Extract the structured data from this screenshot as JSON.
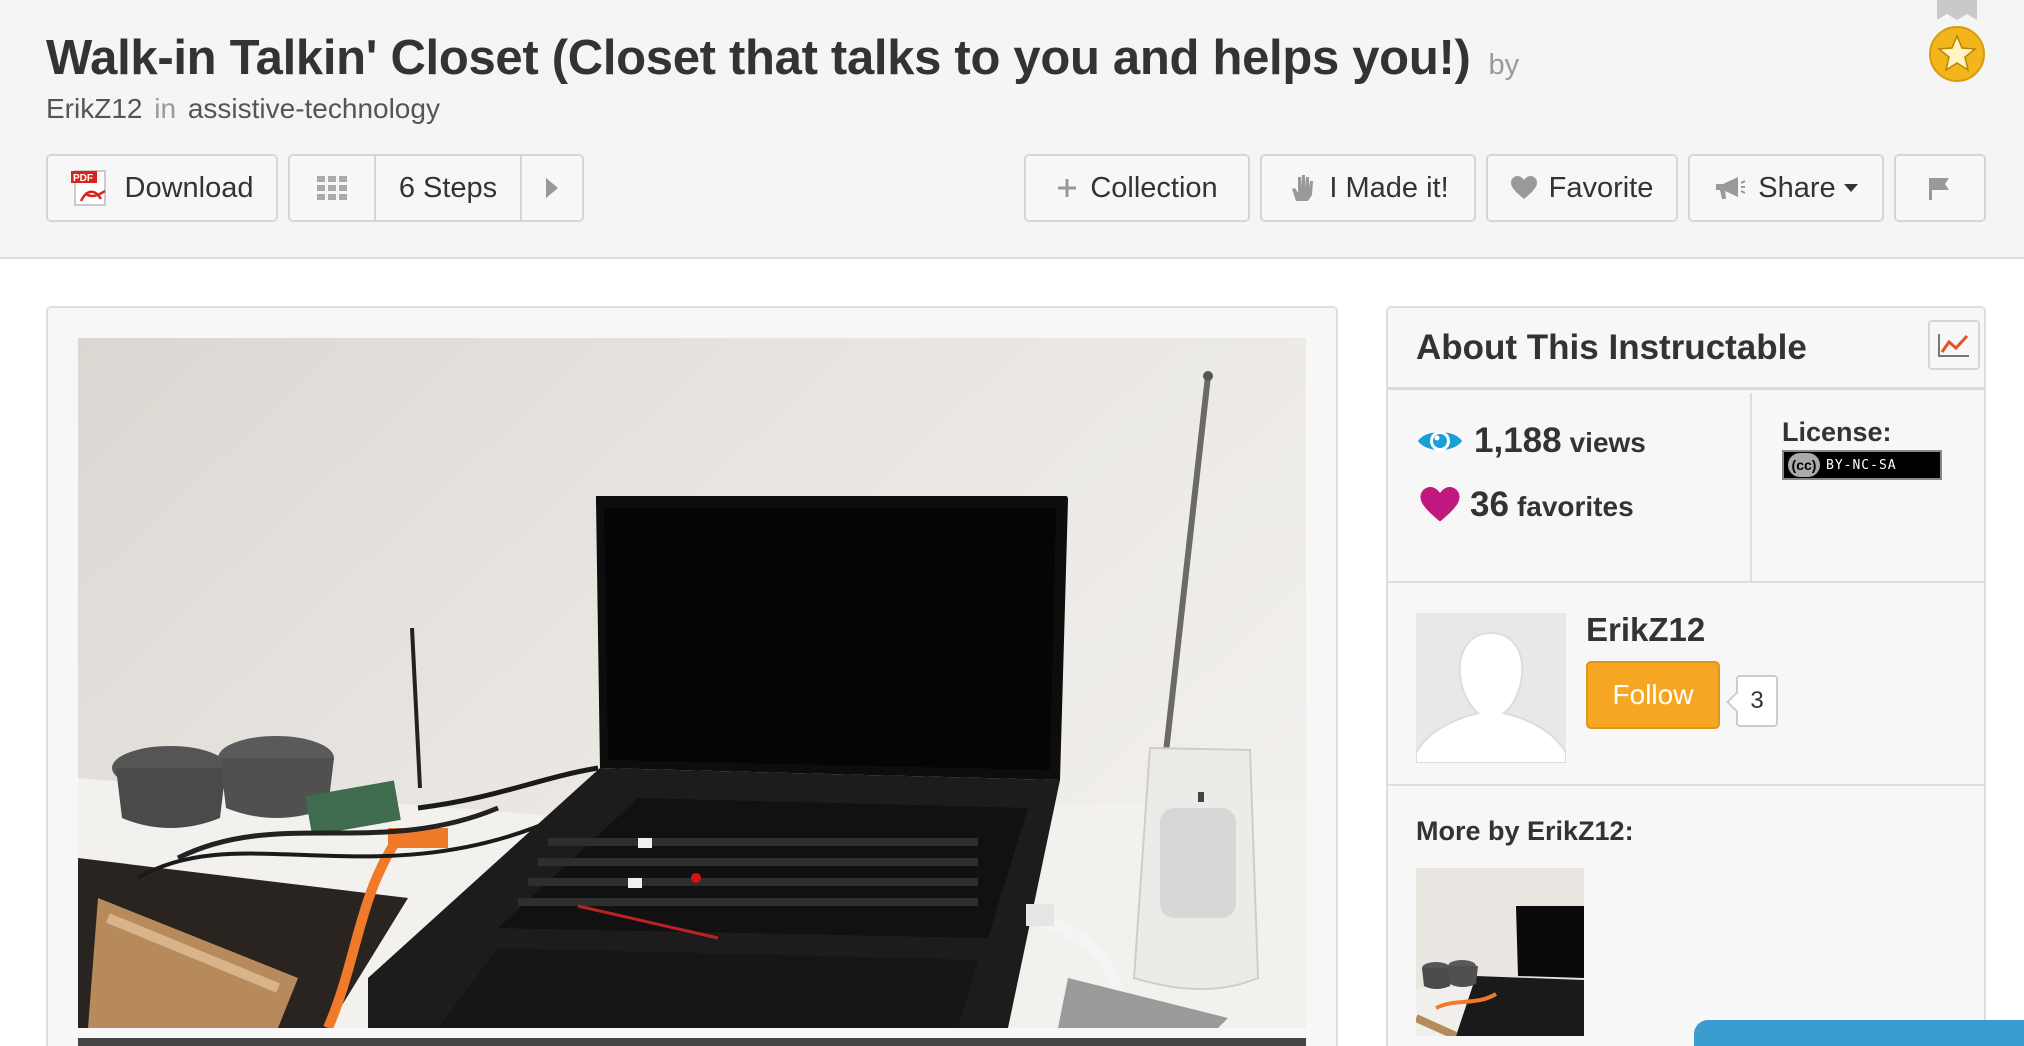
{
  "header": {
    "title": "Walk-in Talkin' Closet (Closet that talks to you and helps you!)",
    "by_label": "by",
    "author": "ErikZ12",
    "in_label": "in",
    "channel": "assistive-technology"
  },
  "toolbar": {
    "download_label": "Download",
    "pdf_icon_text": "PDF",
    "steps_label": "6 Steps",
    "collection_label": "Collection",
    "made_it_label": "I Made it!",
    "favorite_label": "Favorite",
    "share_label": "Share"
  },
  "sidebar": {
    "title": "About This Instructable",
    "views_count": "1,188",
    "views_label": "views",
    "favorites_count": "36",
    "favorites_label": "favorites",
    "license_label": "License:",
    "license_badge_cc": "(cc)",
    "license_badge_text": "BY-NC-SA",
    "author_name": "ErikZ12",
    "follow_label": "Follow",
    "follow_count": "3",
    "more_by_label": "More by ErikZ12:"
  },
  "colors": {
    "follow_orange": "#f5a623",
    "views_eye_blue": "#1a9fd6",
    "favorites_heart": "#c0187f",
    "badge_gold": "#f2b51c",
    "chat_tab_blue": "#3a9ccf"
  }
}
